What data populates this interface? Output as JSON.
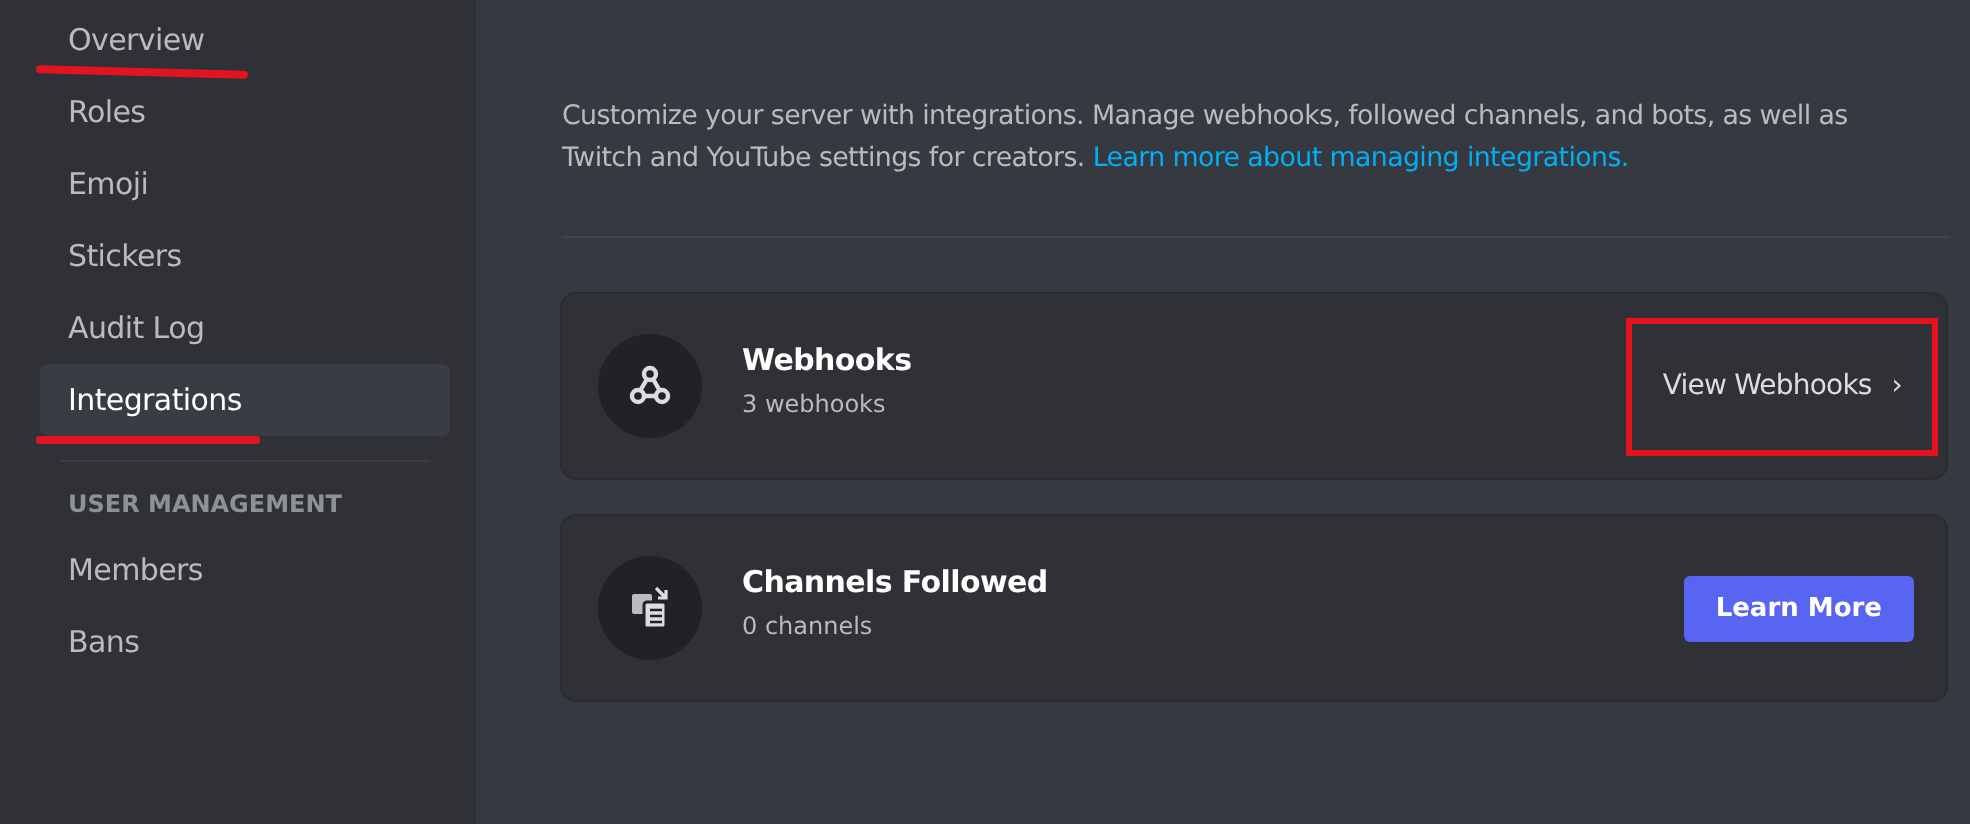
{
  "sidebar": {
    "items": [
      {
        "kind": "item",
        "label": "Overview",
        "selected": false,
        "marked": true
      },
      {
        "kind": "item",
        "label": "Roles",
        "selected": false,
        "marked": false
      },
      {
        "kind": "item",
        "label": "Emoji",
        "selected": false,
        "marked": false
      },
      {
        "kind": "item",
        "label": "Stickers",
        "selected": false,
        "marked": false
      },
      {
        "kind": "item",
        "label": "Audit Log",
        "selected": false,
        "marked": false
      },
      {
        "kind": "item",
        "label": "Integrations",
        "selected": true,
        "marked": true
      },
      {
        "kind": "divider"
      },
      {
        "kind": "header",
        "label": "USER MANAGEMENT"
      },
      {
        "kind": "item",
        "label": "Members",
        "selected": false,
        "marked": false
      },
      {
        "kind": "item",
        "label": "Bans",
        "selected": false,
        "marked": false
      }
    ]
  },
  "description": {
    "text": "Customize your server with integrations. Manage webhooks, followed channels, and bots, as well as Twitch and YouTube settings for creators.",
    "link": "Learn more about managing integrations."
  },
  "cards": [
    {
      "kind": "webhooks",
      "title": "Webhooks",
      "subtitle": "3 webhooks",
      "action": {
        "kind": "link",
        "label": "View Webhooks",
        "chevron": "›",
        "marked": true
      }
    },
    {
      "kind": "channels",
      "title": "Channels Followed",
      "subtitle": "0 channels",
      "action": {
        "kind": "button",
        "label": "Learn More",
        "marked": false
      }
    }
  ]
}
